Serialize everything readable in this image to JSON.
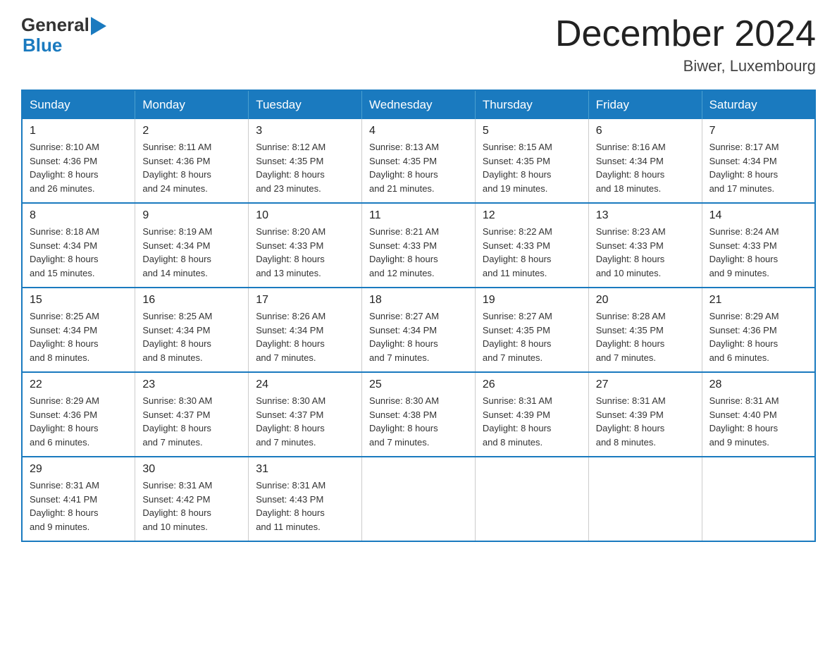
{
  "header": {
    "logo_general": "General",
    "logo_blue": "Blue",
    "month_title": "December 2024",
    "location": "Biwer, Luxembourg"
  },
  "days_of_week": [
    "Sunday",
    "Monday",
    "Tuesday",
    "Wednesday",
    "Thursday",
    "Friday",
    "Saturday"
  ],
  "weeks": [
    [
      {
        "day": "1",
        "sunrise": "8:10 AM",
        "sunset": "4:36 PM",
        "daylight": "8 hours and 26 minutes."
      },
      {
        "day": "2",
        "sunrise": "8:11 AM",
        "sunset": "4:36 PM",
        "daylight": "8 hours and 24 minutes."
      },
      {
        "day": "3",
        "sunrise": "8:12 AM",
        "sunset": "4:35 PM",
        "daylight": "8 hours and 23 minutes."
      },
      {
        "day": "4",
        "sunrise": "8:13 AM",
        "sunset": "4:35 PM",
        "daylight": "8 hours and 21 minutes."
      },
      {
        "day": "5",
        "sunrise": "8:15 AM",
        "sunset": "4:35 PM",
        "daylight": "8 hours and 19 minutes."
      },
      {
        "day": "6",
        "sunrise": "8:16 AM",
        "sunset": "4:34 PM",
        "daylight": "8 hours and 18 minutes."
      },
      {
        "day": "7",
        "sunrise": "8:17 AM",
        "sunset": "4:34 PM",
        "daylight": "8 hours and 17 minutes."
      }
    ],
    [
      {
        "day": "8",
        "sunrise": "8:18 AM",
        "sunset": "4:34 PM",
        "daylight": "8 hours and 15 minutes."
      },
      {
        "day": "9",
        "sunrise": "8:19 AM",
        "sunset": "4:34 PM",
        "daylight": "8 hours and 14 minutes."
      },
      {
        "day": "10",
        "sunrise": "8:20 AM",
        "sunset": "4:33 PM",
        "daylight": "8 hours and 13 minutes."
      },
      {
        "day": "11",
        "sunrise": "8:21 AM",
        "sunset": "4:33 PM",
        "daylight": "8 hours and 12 minutes."
      },
      {
        "day": "12",
        "sunrise": "8:22 AM",
        "sunset": "4:33 PM",
        "daylight": "8 hours and 11 minutes."
      },
      {
        "day": "13",
        "sunrise": "8:23 AM",
        "sunset": "4:33 PM",
        "daylight": "8 hours and 10 minutes."
      },
      {
        "day": "14",
        "sunrise": "8:24 AM",
        "sunset": "4:33 PM",
        "daylight": "8 hours and 9 minutes."
      }
    ],
    [
      {
        "day": "15",
        "sunrise": "8:25 AM",
        "sunset": "4:34 PM",
        "daylight": "8 hours and 8 minutes."
      },
      {
        "day": "16",
        "sunrise": "8:25 AM",
        "sunset": "4:34 PM",
        "daylight": "8 hours and 8 minutes."
      },
      {
        "day": "17",
        "sunrise": "8:26 AM",
        "sunset": "4:34 PM",
        "daylight": "8 hours and 7 minutes."
      },
      {
        "day": "18",
        "sunrise": "8:27 AM",
        "sunset": "4:34 PM",
        "daylight": "8 hours and 7 minutes."
      },
      {
        "day": "19",
        "sunrise": "8:27 AM",
        "sunset": "4:35 PM",
        "daylight": "8 hours and 7 minutes."
      },
      {
        "day": "20",
        "sunrise": "8:28 AM",
        "sunset": "4:35 PM",
        "daylight": "8 hours and 7 minutes."
      },
      {
        "day": "21",
        "sunrise": "8:29 AM",
        "sunset": "4:36 PM",
        "daylight": "8 hours and 6 minutes."
      }
    ],
    [
      {
        "day": "22",
        "sunrise": "8:29 AM",
        "sunset": "4:36 PM",
        "daylight": "8 hours and 6 minutes."
      },
      {
        "day": "23",
        "sunrise": "8:30 AM",
        "sunset": "4:37 PM",
        "daylight": "8 hours and 7 minutes."
      },
      {
        "day": "24",
        "sunrise": "8:30 AM",
        "sunset": "4:37 PM",
        "daylight": "8 hours and 7 minutes."
      },
      {
        "day": "25",
        "sunrise": "8:30 AM",
        "sunset": "4:38 PM",
        "daylight": "8 hours and 7 minutes."
      },
      {
        "day": "26",
        "sunrise": "8:31 AM",
        "sunset": "4:39 PM",
        "daylight": "8 hours and 8 minutes."
      },
      {
        "day": "27",
        "sunrise": "8:31 AM",
        "sunset": "4:39 PM",
        "daylight": "8 hours and 8 minutes."
      },
      {
        "day": "28",
        "sunrise": "8:31 AM",
        "sunset": "4:40 PM",
        "daylight": "8 hours and 9 minutes."
      }
    ],
    [
      {
        "day": "29",
        "sunrise": "8:31 AM",
        "sunset": "4:41 PM",
        "daylight": "8 hours and 9 minutes."
      },
      {
        "day": "30",
        "sunrise": "8:31 AM",
        "sunset": "4:42 PM",
        "daylight": "8 hours and 10 minutes."
      },
      {
        "day": "31",
        "sunrise": "8:31 AM",
        "sunset": "4:43 PM",
        "daylight": "8 hours and 11 minutes."
      },
      null,
      null,
      null,
      null
    ]
  ],
  "labels": {
    "sunrise": "Sunrise:",
    "sunset": "Sunset:",
    "daylight": "Daylight:"
  },
  "colors": {
    "header_bg": "#1a7abf",
    "border": "#1a7abf"
  }
}
